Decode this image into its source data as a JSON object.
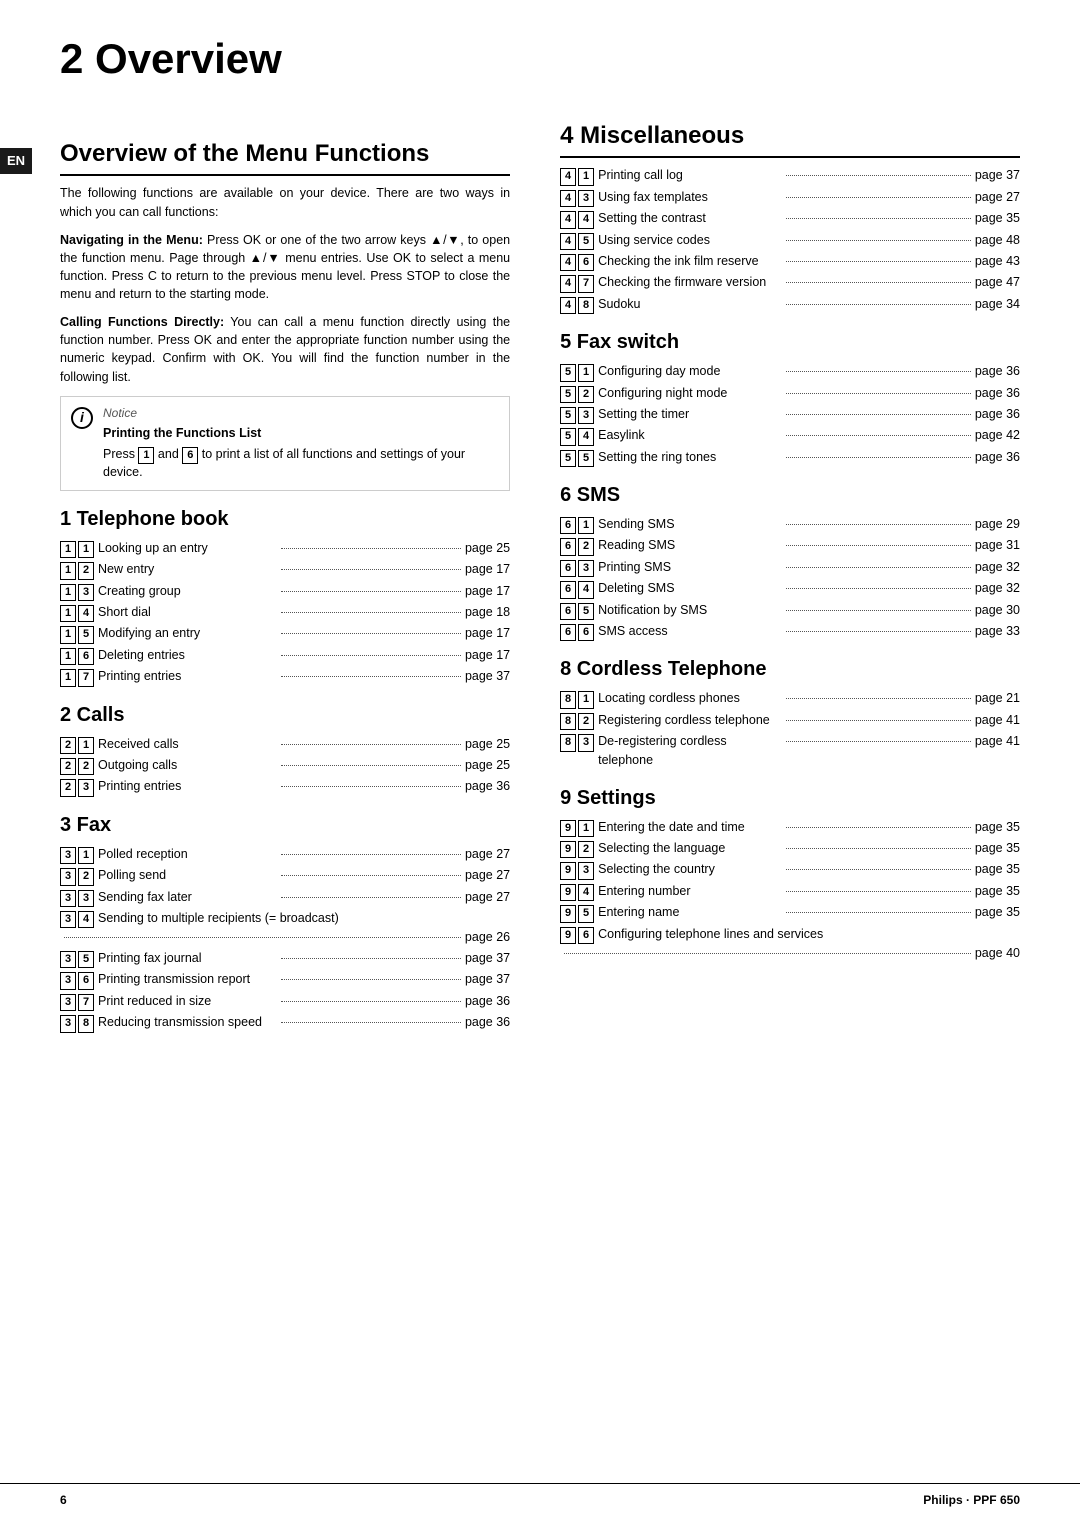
{
  "page": {
    "chapter_number": "2",
    "chapter_title": "Overview",
    "footer_page": "6",
    "footer_brand": "Philips · PPF 650",
    "en_tab": "EN"
  },
  "left_col": {
    "section_heading": "Overview of the Menu Functions",
    "intro_para1": "The following functions are available on your device. There are two ways in which you can call functions:",
    "bold1_title": "Navigating in the Menu:",
    "bold1_text": " Press OK or one of the two arrow keys ▲/▼, to open the function menu. Page through ▲/▼ menu entries. Use OK to select a menu function. Press C to return to the previous menu level. Press STOP to close the menu and return to the starting mode.",
    "bold2_title": "Calling Functions Directly:",
    "bold2_text": " You can call a menu function directly using the function number. Press OK and enter the appropriate function number using the numeric keypad. Confirm with OK. You will find the function number in the following list.",
    "notice_label": "Notice",
    "notice_title": "Printing the Functions List",
    "notice_text": "Press 1 and 6 to print a list of all functions and settings of your device.",
    "notice_code1": "1",
    "notice_code2": "6",
    "sections": [
      {
        "id": "telephone-book",
        "heading": "1 Telephone book",
        "items": [
          {
            "codes": [
              "1",
              "1"
            ],
            "label": "Looking up an entry",
            "page": "page 25"
          },
          {
            "codes": [
              "1",
              "2"
            ],
            "label": "New entry",
            "page": "page 17"
          },
          {
            "codes": [
              "1",
              "3"
            ],
            "label": "Creating group",
            "page": "page 17"
          },
          {
            "codes": [
              "1",
              "4"
            ],
            "label": "Short dial",
            "page": "page 18"
          },
          {
            "codes": [
              "1",
              "5"
            ],
            "label": "Modifying an entry",
            "page": "page 17"
          },
          {
            "codes": [
              "1",
              "6"
            ],
            "label": "Deleting entries",
            "page": "page 17"
          },
          {
            "codes": [
              "1",
              "7"
            ],
            "label": "Printing entries",
            "page": "page 37"
          }
        ]
      },
      {
        "id": "calls",
        "heading": "2 Calls",
        "items": [
          {
            "codes": [
              "2",
              "1"
            ],
            "label": "Received calls",
            "page": "page 25"
          },
          {
            "codes": [
              "2",
              "2"
            ],
            "label": "Outgoing calls",
            "page": "page 25"
          },
          {
            "codes": [
              "2",
              "3"
            ],
            "label": "Printing entries",
            "page": "page 36"
          }
        ]
      },
      {
        "id": "fax",
        "heading": "3 Fax",
        "items": [
          {
            "codes": [
              "3",
              "1"
            ],
            "label": "Polled reception",
            "page": "page 27",
            "wrap": false
          },
          {
            "codes": [
              "3",
              "2"
            ],
            "label": "Polling send",
            "page": "page 27",
            "wrap": false
          },
          {
            "codes": [
              "3",
              "3"
            ],
            "label": "Sending fax later",
            "page": "page 27",
            "wrap": false
          },
          {
            "codes": [
              "3",
              "4"
            ],
            "label": "Sending to multiple recipients (= broadcast)",
            "page": "page 26",
            "wrap": true
          },
          {
            "codes": [
              "3",
              "5"
            ],
            "label": "Printing fax journal",
            "page": "page 37",
            "wrap": false
          },
          {
            "codes": [
              "3",
              "6"
            ],
            "label": "Printing transmission report",
            "page": "page 37",
            "wrap": false
          },
          {
            "codes": [
              "3",
              "7"
            ],
            "label": "Print reduced in size",
            "page": "page 36",
            "wrap": false
          },
          {
            "codes": [
              "3",
              "8"
            ],
            "label": "Reducing transmission speed",
            "page": "page 36",
            "wrap": false
          }
        ]
      }
    ]
  },
  "right_col": {
    "sections": [
      {
        "id": "miscellaneous",
        "heading": "4 Miscellaneous",
        "items": [
          {
            "codes": [
              "4",
              "1"
            ],
            "label": "Printing call log",
            "page": "page 37"
          },
          {
            "codes": [
              "4",
              "3"
            ],
            "label": "Using fax templates",
            "page": "page 27"
          },
          {
            "codes": [
              "4",
              "4"
            ],
            "label": "Setting the contrast",
            "page": "page 35"
          },
          {
            "codes": [
              "4",
              "5"
            ],
            "label": "Using service codes",
            "page": "page 48"
          },
          {
            "codes": [
              "4",
              "6"
            ],
            "label": "Checking the ink film reserve",
            "page": "page 43"
          },
          {
            "codes": [
              "4",
              "7"
            ],
            "label": "Checking the firmware version",
            "page": "page 47"
          },
          {
            "codes": [
              "4",
              "8"
            ],
            "label": "Sudoku",
            "page": "page 34"
          }
        ]
      },
      {
        "id": "fax-switch",
        "heading": "5 Fax switch",
        "items": [
          {
            "codes": [
              "5",
              "1"
            ],
            "label": "Configuring day mode",
            "page": "page 36"
          },
          {
            "codes": [
              "5",
              "2"
            ],
            "label": "Configuring night mode",
            "page": "page 36"
          },
          {
            "codes": [
              "5",
              "3"
            ],
            "label": "Setting the timer",
            "page": "page 36"
          },
          {
            "codes": [
              "5",
              "4"
            ],
            "label": "Easylink",
            "page": "page 42"
          },
          {
            "codes": [
              "5",
              "5"
            ],
            "label": "Setting the ring tones",
            "page": "page 36"
          }
        ]
      },
      {
        "id": "sms",
        "heading": "6 SMS",
        "items": [
          {
            "codes": [
              "6",
              "1"
            ],
            "label": "Sending SMS",
            "page": "page 29"
          },
          {
            "codes": [
              "6",
              "2"
            ],
            "label": "Reading SMS",
            "page": "page 31"
          },
          {
            "codes": [
              "6",
              "3"
            ],
            "label": "Printing SMS",
            "page": "page 32"
          },
          {
            "codes": [
              "6",
              "4"
            ],
            "label": "Deleting SMS",
            "page": "page 32"
          },
          {
            "codes": [
              "6",
              "5"
            ],
            "label": "Notification by SMS",
            "page": "page 30"
          },
          {
            "codes": [
              "6",
              "6"
            ],
            "label": "SMS access",
            "page": "page 33"
          }
        ]
      },
      {
        "id": "cordless",
        "heading": "8 Cordless Telephone",
        "items": [
          {
            "codes": [
              "8",
              "1"
            ],
            "label": "Locating cordless phones",
            "page": "page 21"
          },
          {
            "codes": [
              "8",
              "2"
            ],
            "label": "Registering cordless telephone",
            "page": "page 41"
          },
          {
            "codes": [
              "8",
              "3"
            ],
            "label": "De-registering cordless telephone",
            "page": "page 41"
          }
        ]
      },
      {
        "id": "settings",
        "heading": "9 Settings",
        "items": [
          {
            "codes": [
              "9",
              "1"
            ],
            "label": "Entering the date and time",
            "page": "page 35"
          },
          {
            "codes": [
              "9",
              "2"
            ],
            "label": "Selecting the language",
            "page": "page 35"
          },
          {
            "codes": [
              "9",
              "3"
            ],
            "label": "Selecting the country",
            "page": "page 35"
          },
          {
            "codes": [
              "9",
              "4"
            ],
            "label": "Entering number",
            "page": "page 35"
          },
          {
            "codes": [
              "9",
              "5"
            ],
            "label": "Entering name",
            "page": "page 35"
          },
          {
            "codes": [
              "9",
              "6"
            ],
            "label": "Configuring telephone lines and services",
            "page": "page 40",
            "wrap": true
          }
        ]
      }
    ]
  }
}
